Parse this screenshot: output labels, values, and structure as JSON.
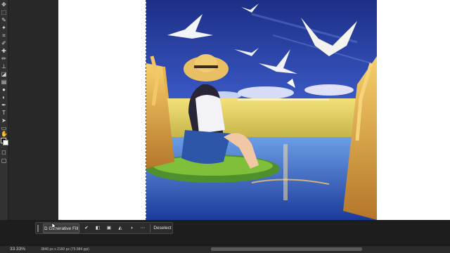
{
  "taskbar": {
    "generative_fill_label": "Generative Fill",
    "deselect_label": "Deselect"
  },
  "status": {
    "zoom": "33.33%",
    "doc_info": "3840 px x 2160 px (75.984 ppi)"
  },
  "icons": {
    "tools": [
      "move-icon",
      "marquee-icon",
      "lasso-icon",
      "quick-select-icon",
      "crop-icon",
      "frame-icon",
      "eyedropper-icon",
      "healing-brush-icon",
      "brush-icon",
      "clone-stamp-icon",
      "history-brush-icon",
      "eraser-icon",
      "gradient-icon",
      "blur-icon",
      "dodge-icon",
      "pen-icon",
      "type-icon",
      "path-select-icon",
      "rectangle-icon",
      "hand-icon",
      "zoom-icon"
    ]
  },
  "colors": {
    "ui_dark": "#282828",
    "panel": "#323232",
    "sky": "#2a3f9a",
    "grass_gold": "#e0a83a"
  }
}
